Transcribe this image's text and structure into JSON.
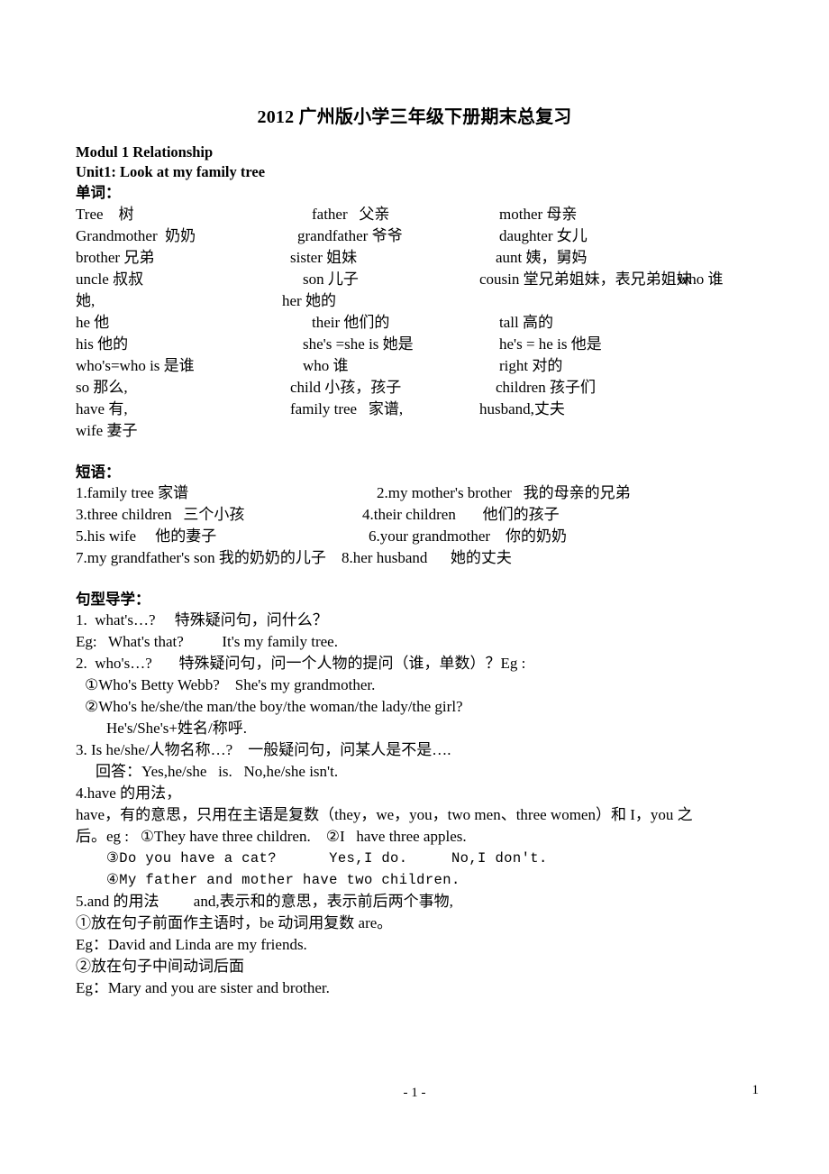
{
  "document": {
    "title": "2012 广州版小学三年级下册期末总复习",
    "module_heading": "Modul 1 Relationship",
    "unit_heading": "Unit1: Look at my family tree",
    "vocab_heading": "单词：",
    "phrases_heading": "短语：",
    "patterns_heading": "句型导学："
  },
  "vocabulary": {
    "rows": [
      {
        "c1": "Tree    树",
        "c2": "father   父亲",
        "c3": "mother 母亲"
      },
      {
        "c1": "Grandmother  奶奶",
        "c2": "grandfather 爷爷",
        "c3": "daughter 女儿"
      },
      {
        "c1": "brother 兄弟",
        "c2": "sister 姐妹",
        "c3": "aunt 姨，舅妈"
      },
      {
        "c1": "uncle 叔叔",
        "c2": "son 儿子",
        "c3": "cousin 堂兄弟姐妹，表兄弟姐妹",
        "c4": "who 谁"
      },
      {
        "c1": "她,",
        "c2": "her 她的"
      },
      {
        "c1": "he 他",
        "c2": "their 他们的",
        "c3": "tall 高的"
      },
      {
        "c1": "his 他的",
        "c2": "she's =she is 她是",
        "c3": "he's = he is 他是"
      },
      {
        "c1": "who's=who is 是谁",
        "c2": "who 谁",
        "c3": "right 对的"
      },
      {
        "c1": "so 那么,",
        "c2": "child 小孩，孩子",
        "c3": "children 孩子们"
      },
      {
        "c1": "have 有,",
        "c2": "family tree   家谱,",
        "c3": "husband,丈夫"
      },
      {
        "c1": "wife 妻子"
      }
    ]
  },
  "phrases": {
    "rows": [
      {
        "left": "1.family tree 家谱",
        "right": "2.my mother's brother   我的母亲的兄弟"
      },
      {
        "left": "3.three children   三个小孩",
        "right": "4.their children       他们的孩子"
      },
      {
        "left": "5.his wife     他的妻子",
        "right": "6.your grandmother    你的奶奶"
      },
      {
        "left": "7.my grandfather's son 我的奶奶的儿子",
        "right": "8.her husband      她的丈夫"
      }
    ]
  },
  "patterns": {
    "lines": [
      {
        "text": "1.  what's…?     特殊疑问句，问什么？",
        "style": "normal",
        "indent": 0
      },
      {
        "text": "Eg:   What's that?          It's my family tree.",
        "style": "normal",
        "indent": 0
      },
      {
        "text": "2.  who's…?       特殊疑问句，问一个人物的提问（谁，单数）？Eg :",
        "style": "normal",
        "indent": 0
      },
      {
        "text": "①Who's Betty Webb?    She's my grandmother.",
        "style": "normal",
        "indent": 1
      },
      {
        "text": "②Who's he/she/the man/the boy/the woman/the lady/the girl?",
        "style": "normal",
        "indent": 1
      },
      {
        "text": "He's/She's+姓名/称呼.",
        "style": "normal",
        "indent": 2
      },
      {
        "text": "3. Is he/she/人物名称…?    一般疑问句，问某人是不是….",
        "style": "normal",
        "indent": 0
      },
      {
        "text": "回答：Yes,he/she   is.   No,he/she isn't.",
        "style": "normal",
        "indent": 2
      },
      {
        "text": "4.have 的用法，",
        "style": "normal",
        "indent": 0
      },
      {
        "text": "have，有的意思，只用在主语是复数（they，we，you，two men、three women）和 I，you 之",
        "style": "normal",
        "indent": 0
      },
      {
        "text": "后。eg :   ①They have three children.    ②I   have three apples.",
        "style": "normal",
        "indent": 0
      },
      {
        "text": "③Do you have a cat?      Yes,I do.     No,I don't.",
        "style": "mono",
        "indent": 2
      },
      {
        "text": "④My father and mother have two children.",
        "style": "mono",
        "indent": 2
      },
      {
        "text": "5.and 的用法         and,表示和的意思，表示前后两个事物,",
        "style": "normal",
        "indent": 0
      },
      {
        "text": "①放在句子前面作主语时，be 动词用复数 are。",
        "style": "normal",
        "indent": 0
      },
      {
        "text": "Eg：David and Linda are my friends.",
        "style": "normal",
        "indent": 0
      },
      {
        "text": "②放在句子中间动词后面",
        "style": "normal",
        "indent": 0
      },
      {
        "text": "Eg：Mary and you are sister and brother.",
        "style": "normal",
        "indent": 0
      }
    ]
  },
  "footer": {
    "page_marker": "- 1 -",
    "page_number": "1"
  }
}
